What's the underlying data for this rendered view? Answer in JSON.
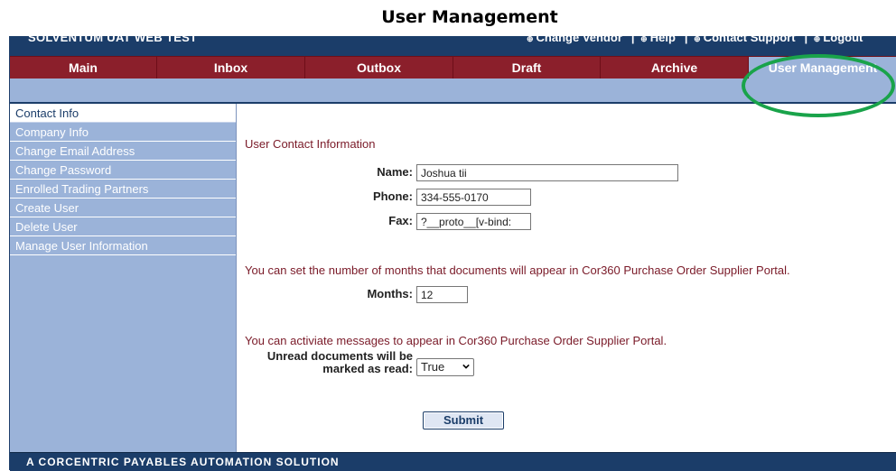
{
  "document_title": "User Management",
  "header": {
    "app_name": "SOLVENTUM UAT WEB TEST",
    "links": [
      "Change Vendor",
      "Help",
      "Contact Support",
      "Logout"
    ]
  },
  "nav": {
    "tabs": [
      {
        "label": "Main"
      },
      {
        "label": "Inbox"
      },
      {
        "label": "Outbox"
      },
      {
        "label": "Draft"
      },
      {
        "label": "Archive"
      },
      {
        "label": "User Management",
        "active": true
      }
    ]
  },
  "sidebar": {
    "items": [
      {
        "label": "Contact Info",
        "active": true
      },
      {
        "label": "Company Info"
      },
      {
        "label": "Change Email Address"
      },
      {
        "label": "Change Password"
      },
      {
        "label": "Enrolled Trading Partners"
      },
      {
        "label": "Create User"
      },
      {
        "label": "Delete User"
      },
      {
        "label": "Manage User Information"
      }
    ]
  },
  "form": {
    "section_title": "User Contact Information",
    "name_label": "Name:",
    "name_value": "Joshua tii",
    "phone_label": "Phone:",
    "phone_value": "334-555-0170",
    "fax_label": "Fax:",
    "fax_value": "?__proto__[v-bind:",
    "months_note": "You can set the number of months that documents will appear in Cor360 Purchase Order Supplier Portal.",
    "months_label": "Months:",
    "months_value": "12",
    "messages_note": "You can activiate messages to appear in Cor360 Purchase Order Supplier Portal.",
    "unread_label_line1": "Unread documents will be",
    "unread_label_line2": "marked as read:",
    "unread_value": "True",
    "submit_label": "Submit"
  },
  "footer": {
    "text": "A CORCENTRIC PAYABLES AUTOMATION SOLUTION"
  },
  "colors": {
    "navy": "#1b3d69",
    "maroon": "#8b1f2b",
    "light_blue": "#9bb3d9",
    "text_red": "#7a1a28",
    "highlight_green": "#19a34a"
  }
}
